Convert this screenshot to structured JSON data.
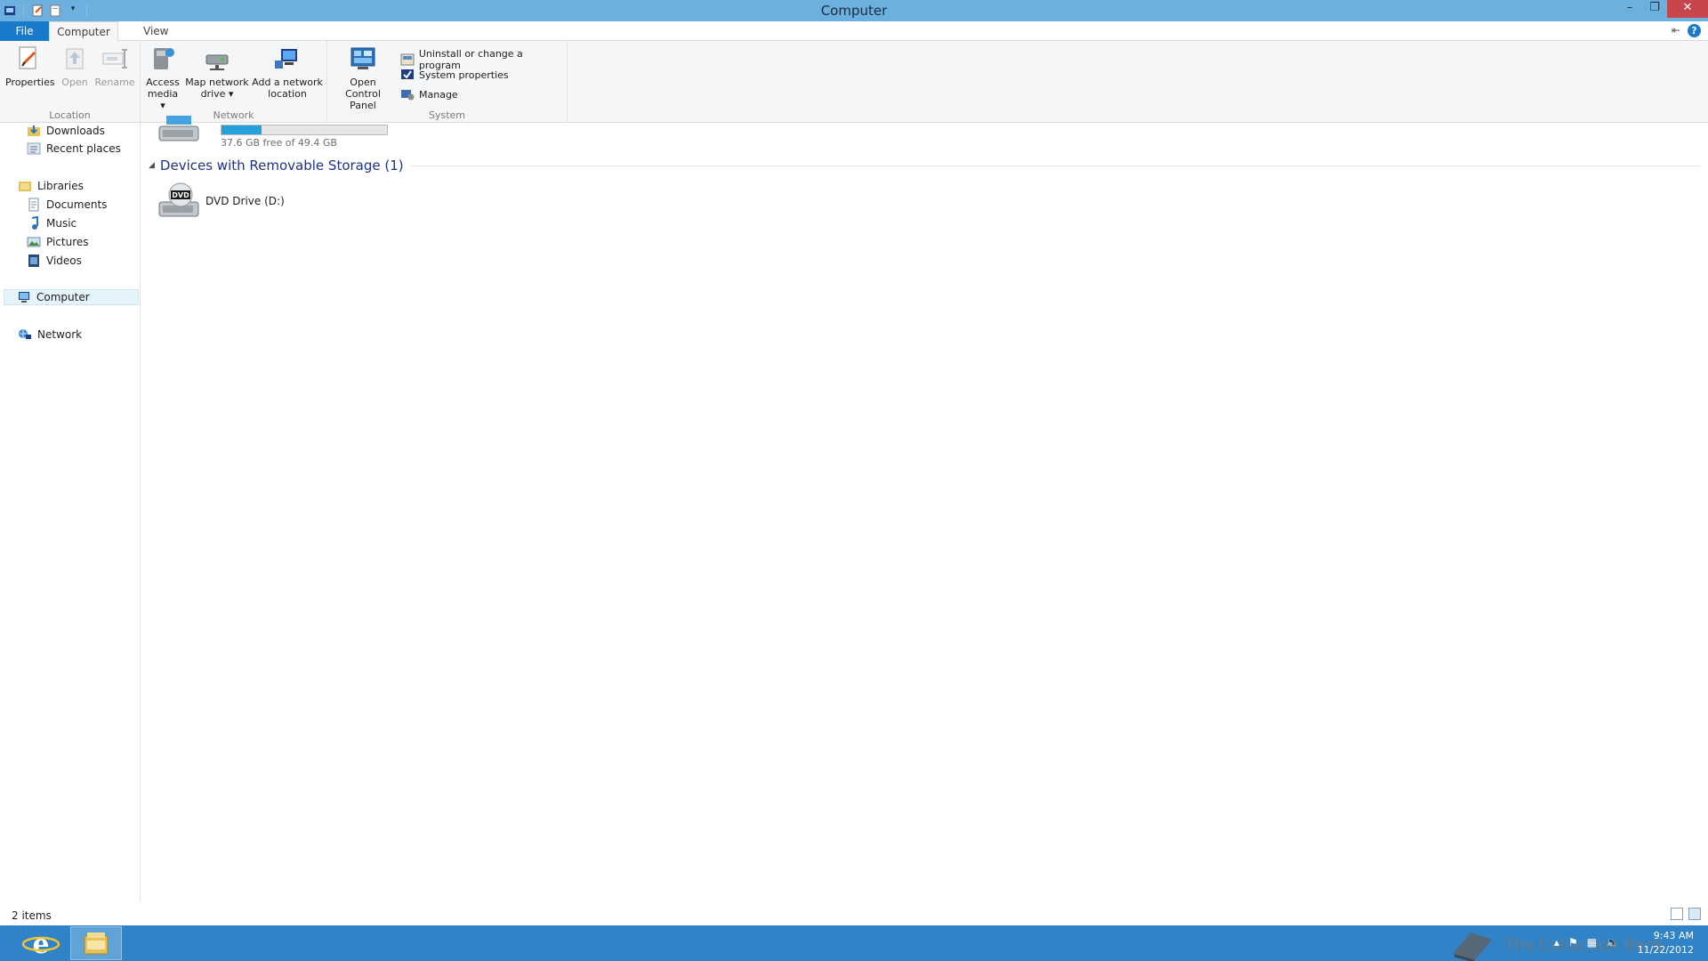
{
  "window": {
    "title": "Computer"
  },
  "ribbon_tabs": {
    "file": "File",
    "computer": "Computer",
    "view": "View"
  },
  "ribbon": {
    "location": {
      "label": "Location",
      "properties": "Properties",
      "open": "Open",
      "rename": "Rename"
    },
    "network": {
      "label": "Network",
      "access_media_1": "Access",
      "access_media_2": "media ▾",
      "map_drive_1": "Map network",
      "map_drive_2": "drive ▾",
      "add_location_1": "Add a network",
      "add_location_2": "location"
    },
    "system": {
      "label": "System",
      "control_panel_1": "Open Control",
      "control_panel_2": "Panel",
      "uninstall": "Uninstall or change a program",
      "system_properties": "System properties",
      "manage": "Manage"
    }
  },
  "nav": {
    "downloads": "Downloads",
    "recent": "Recent places",
    "libraries": "Libraries",
    "documents": "Documents",
    "music": "Music",
    "pictures": "Pictures",
    "videos": "Videos",
    "computer": "Computer",
    "network": "Network"
  },
  "content": {
    "drive_free": "37.6 GB free of 49.4 GB",
    "drive_used_fraction": 0.24,
    "section_title": "Devices with Removable Storage (1)",
    "dvd_label": "DVD Drive (D:)"
  },
  "status": {
    "count": "2 items"
  },
  "taskbar": {
    "time": "9:43 AM",
    "date": "11/22/2012",
    "watermark": "The Collection Book"
  }
}
